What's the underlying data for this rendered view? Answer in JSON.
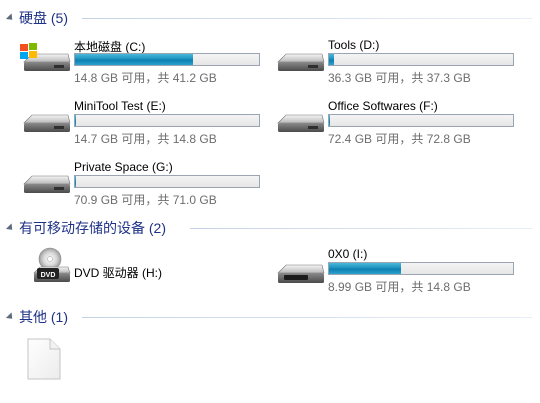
{
  "groups": [
    {
      "title": "硬盘 (5)"
    },
    {
      "title": "有可移动存储的设备 (2)"
    },
    {
      "title": "其他 (1)"
    }
  ],
  "drives": [
    {
      "name": "本地磁盘 (C:)",
      "info": "14.8 GB 可用，共 41.2 GB",
      "used_fraction": 0.64,
      "icon": "windows-drive-icon"
    },
    {
      "name": "Tools (D:)",
      "info": "36.3 GB 可用，共 37.3 GB",
      "used_fraction": 0.027,
      "icon": "hard-drive-icon"
    },
    {
      "name": "MiniTool Test (E:)",
      "info": "14.7 GB 可用，共 14.8 GB",
      "used_fraction": 0.007,
      "icon": "hard-drive-icon"
    },
    {
      "name": "Office Softwares (F:)",
      "info": "72.4 GB 可用，共 72.8 GB",
      "used_fraction": 0.006,
      "icon": "hard-drive-icon"
    },
    {
      "name": "Private Space (G:)",
      "info": "70.9 GB 可用，共 71.0 GB",
      "used_fraction": 0.002,
      "icon": "hard-drive-icon"
    }
  ],
  "removable": [
    {
      "name": "DVD 驱动器 (H:)",
      "icon": "dvd-drive-icon",
      "icon_label": "DVD"
    },
    {
      "name": "0X0 (I:)",
      "info": "8.99 GB 可用，共 14.8 GB",
      "used_fraction": 0.39,
      "icon": "removable-drive-icon"
    }
  ],
  "other": [
    {
      "name": "",
      "icon": "blank-file-icon"
    }
  ],
  "colors": {
    "group_title": "#1e3287",
    "bar_fill": "#1e93c1",
    "info_text": "#6d6d6d"
  }
}
